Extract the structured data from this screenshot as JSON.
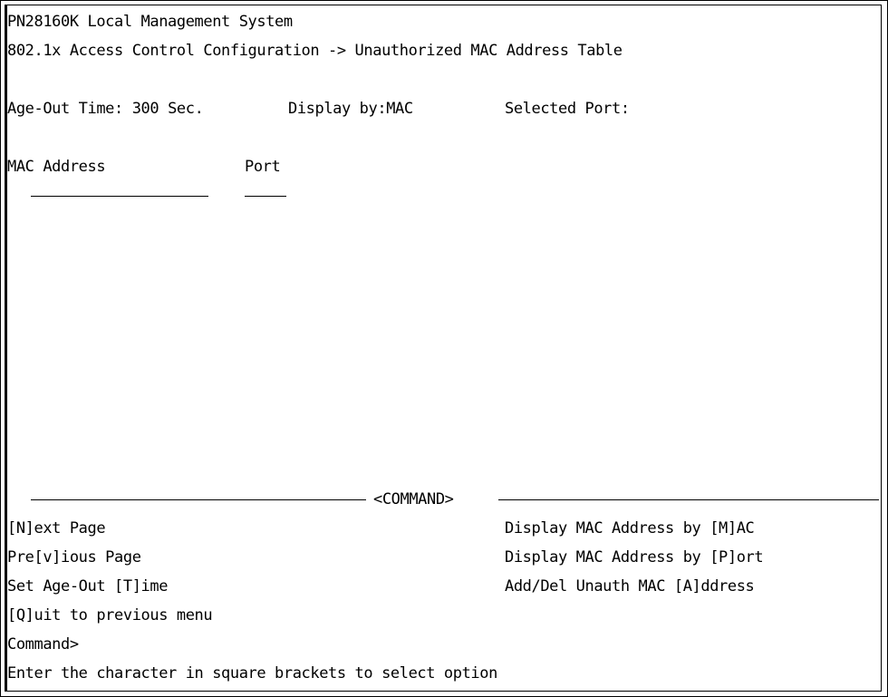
{
  "header": {
    "system_title": "PN28160K Local Management System",
    "breadcrumb": "802.1x Access Control Configuration -> Unauthorized MAC Address Table"
  },
  "status": {
    "age_out_label": "Age-Out Time:",
    "age_out_value": "300",
    "age_out_unit": "Sec.",
    "display_by_label": "Display by:",
    "display_by_value": "MAC",
    "selected_port_label": "Selected Port:",
    "selected_port_value": ""
  },
  "table": {
    "columns": [
      "MAC Address",
      "Port"
    ],
    "rows": []
  },
  "command_section": {
    "title": "<COMMAND>",
    "left_commands": [
      "[N]ext Page",
      "Pre[v]ious Page",
      "Set Age-Out [T]ime",
      "[Q]uit to previous menu"
    ],
    "right_commands": [
      "Display MAC Address by [M]AC",
      "Display MAC Address by [P]ort",
      "Add/Del Unauth MAC [A]ddress"
    ],
    "prompt": "Command>",
    "hint": "Enter the character in square brackets to select option"
  }
}
